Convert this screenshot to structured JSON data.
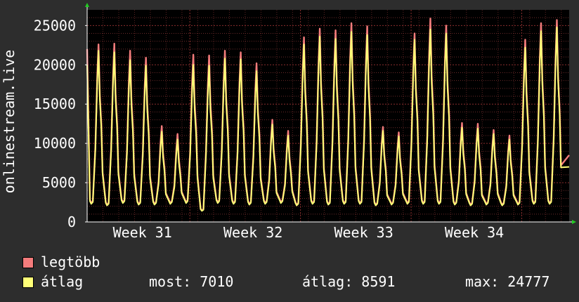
{
  "chart_data": {
    "type": "line",
    "ylabel": "onlinestream.live",
    "ylim": [
      0,
      27000
    ],
    "yticks": [
      0,
      5000,
      10000,
      15000,
      20000,
      25000
    ],
    "ytick_labels": [
      "0",
      "5000",
      "10000",
      "15000",
      "20000",
      "25000"
    ],
    "x_unit": "days",
    "xlim": [
      0,
      30.5
    ],
    "xticks": [
      {
        "label": "Week 31",
        "x": 3
      },
      {
        "label": "Week 32",
        "x": 10
      },
      {
        "label": "Week 33",
        "x": 17
      },
      {
        "label": "Week 34",
        "x": 24
      }
    ],
    "grid": true,
    "daily_peaks": {
      "max": [
        22600,
        22700,
        21800,
        20900,
        12200,
        11200,
        21300,
        21200,
        21800,
        21600,
        20200,
        13000,
        11600,
        23500,
        24600,
        24400,
        25300,
        24900,
        12100,
        11400,
        24000,
        25900,
        25000,
        12600,
        12500,
        11700,
        11000,
        23200,
        25300,
        25700
      ],
      "avg": [
        21800,
        21600,
        20600,
        19900,
        11500,
        10500,
        20000,
        19900,
        20800,
        20700,
        19200,
        12400,
        11000,
        22600,
        23600,
        23300,
        24200,
        23800,
        11600,
        10900,
        23200,
        24500,
        24000,
        12000,
        11900,
        11200,
        10500,
        22200,
        24300,
        24777
      ]
    },
    "daily_lows": [
      2300,
      2100,
      2400,
      2200,
      2200,
      2300,
      2400,
      1400,
      2400,
      2300,
      2200,
      2300,
      2400,
      2100,
      2300,
      2200,
      2300,
      2300,
      2100,
      2200,
      2300,
      2300,
      2300,
      2200,
      2100,
      2200,
      2100,
      2200,
      2300,
      2300
    ],
    "start_value": {
      "max": 22000,
      "avg": 20000
    },
    "end_value": {
      "max": 8500,
      "avg": 7010
    },
    "series": [
      {
        "name": "legtöbb",
        "color": "#f47c7c"
      },
      {
        "name": "átlag",
        "color": "#ffff77"
      }
    ]
  },
  "legend": {
    "max_label": "legtöbb",
    "avg_label": "átlag",
    "max_color": "#f47c7c",
    "avg_color": "#ffff77"
  },
  "stats": {
    "now": "most: 7010",
    "avg": "átlag: 8591",
    "max": "max: 24777"
  }
}
